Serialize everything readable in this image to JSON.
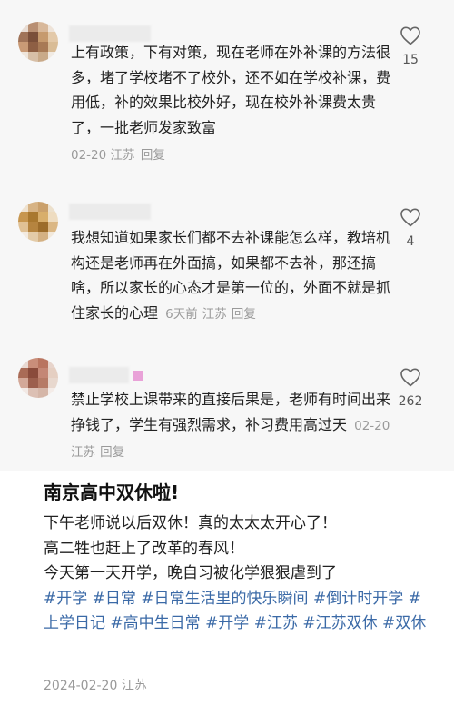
{
  "comments": [
    {
      "text": "上有政策，下有对策，现在老师在外补课的方法很多，堵了学校堵不了校外，还不如在学校补课，费用低，补的效果比校外好，现在校外补课费太贵了，一批老师发家致富",
      "date": "02-20",
      "location": "江苏",
      "reply": "回复",
      "likes": "15"
    },
    {
      "text": "我想知道如果家长们都不去补课能怎么样，教培机构还是老师再在外面搞，如果都不去补，那还搞啥，所以家长的心态才是第一位的，外面不就是抓住家长的心理",
      "date": "6天前",
      "location": "江苏",
      "reply": "回复",
      "likes": "4"
    },
    {
      "text": "禁止学校上课带来的直接后果是，老师有时间出来挣钱了，学生有强烈需求，补习费用高过天",
      "date": "02-20",
      "location": "江苏",
      "reply": "回复",
      "likes": "262"
    }
  ],
  "post": {
    "title": "南京高中双休啦!",
    "lines": [
      "下午老师说以后双休！真的太太太开心了！",
      "高二牲也赶上了改革的春风！",
      "今天第一天开学，晚自习被化学狠狠虐到了"
    ],
    "tags": [
      "#开学",
      "#日常",
      "#日常生活里的快乐瞬间",
      "#倒计时开学",
      "#上学日记",
      "#高中生日常",
      "#开学",
      "#江苏",
      "#江苏双休",
      "#双休"
    ],
    "date": "2024-02-20",
    "location": "江苏"
  },
  "colors": {
    "accent_tag": "#3b6aa7",
    "meta_gray": "#9a9a9a",
    "comment_bg": "#f7f7f7"
  },
  "icons": {
    "like": "heart-outline-icon"
  }
}
